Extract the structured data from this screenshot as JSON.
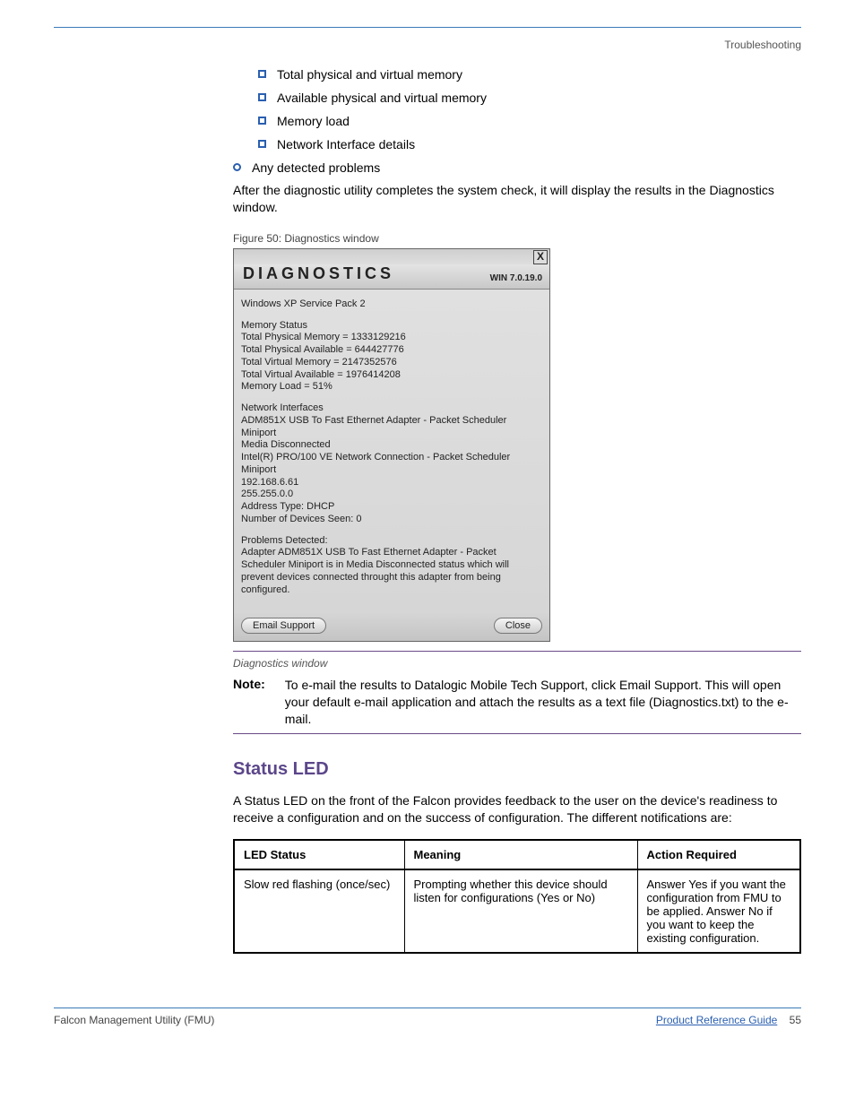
{
  "header": {
    "label": "Troubleshooting"
  },
  "bullets": {
    "items": [
      {
        "text": "Total physical and virtual memory"
      },
      {
        "text": "Available physical and virtual memory"
      },
      {
        "text": "Memory load"
      },
      {
        "text": "Network Interface details"
      }
    ],
    "problems_label": "Any detected problems"
  },
  "paragraph": "After the diagnostic utility completes the system check, it will display the results in the Diagnostics window.",
  "figure_label": "Figure 50: Diagnostics window",
  "dialog": {
    "title": "DIAGNOSTICS",
    "version": "WIN 7.0.19.0",
    "os_line": "Windows XP Service Pack 2",
    "memory_header": "Memory Status",
    "memory_lines": [
      "Total Physical Memory = 1333129216",
      "Total Physical Available = 644427776",
      "Total Virtual Memory = 2147352576",
      "Total Virtual Available = 1976414208",
      "Memory Load = 51%"
    ],
    "network_header": "Network Interfaces",
    "network_lines": [
      "ADM851X USB To Fast Ethernet Adapter - Packet Scheduler Miniport",
      "Media Disconnected",
      "Intel(R) PRO/100 VE Network Connection - Packet Scheduler Miniport",
      "192.168.6.61",
      "255.255.0.0",
      "Address Type: DHCP",
      "Number of Devices Seen: 0"
    ],
    "problems_header": "Problems Detected:",
    "problems_text": "Adapter ADM851X USB To Fast Ethernet Adapter - Packet Scheduler Miniport is in Media Disconnected status which will prevent devices connected throught this adapter from being configured.",
    "buttons": {
      "email": "Email Support",
      "close": "Close"
    }
  },
  "caption_label": "Diagnostics window",
  "note": {
    "key": "Note:",
    "text": "To e-mail the results to Datalogic Mobile Tech Support, click Email Support. This will open your default e-mail application and attach the results as a text file (Diagnostics.txt) to the e-mail."
  },
  "section": {
    "heading": "Status LED",
    "para": "A Status LED on the front of the Falcon provides feedback to the user on the device's readiness to receive a configuration and on the success of configuration. The different notifications are:",
    "table": {
      "headers": [
        "LED Status",
        "Meaning",
        "Action Required"
      ],
      "row": {
        "status": "Slow red flashing (once/sec)",
        "meaning": "Prompting whether this device should listen for configurations (Yes or No)",
        "action": "Answer Yes if you want the configuration from FMU to be applied. Answer No if you want to keep the existing configuration."
      }
    }
  },
  "footer": {
    "left": "Falcon Management Utility (FMU)",
    "link": "Product Reference Guide",
    "page": "55"
  }
}
